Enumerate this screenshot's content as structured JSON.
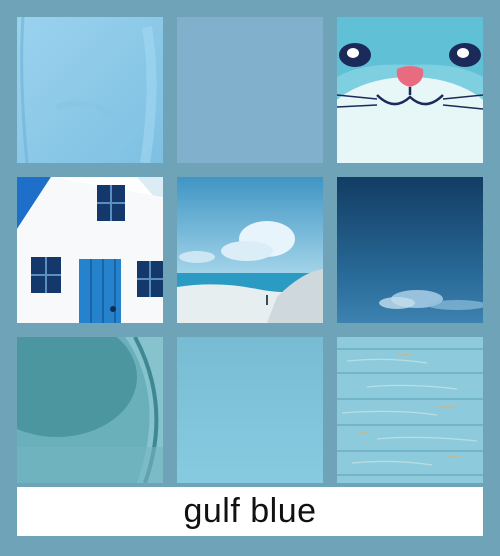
{
  "palette": {
    "caption": "gulf blue",
    "background": "#6ea3b8",
    "swatches": [
      {
        "icon": "blue-shirt-fabric",
        "color": "#8fc9e6"
      },
      {
        "icon": "flat-blue-swatch",
        "color": "#80b0cc"
      },
      {
        "icon": "cartoon-cat-face",
        "color": "#a9dbe6"
      },
      {
        "icon": "white-cottage-blue-door",
        "color": "#1d6fc9"
      },
      {
        "icon": "beach-seascape",
        "color": "#4aa0c8"
      },
      {
        "icon": "deep-blue-sky-clouds",
        "color": "#1a4e78"
      },
      {
        "icon": "teal-mug-closeup",
        "color": "#5aa0ac"
      },
      {
        "icon": "light-teal-swatch",
        "color": "#7fc4d9"
      },
      {
        "icon": "painted-blue-wood",
        "color": "#8ecbdc"
      }
    ]
  }
}
